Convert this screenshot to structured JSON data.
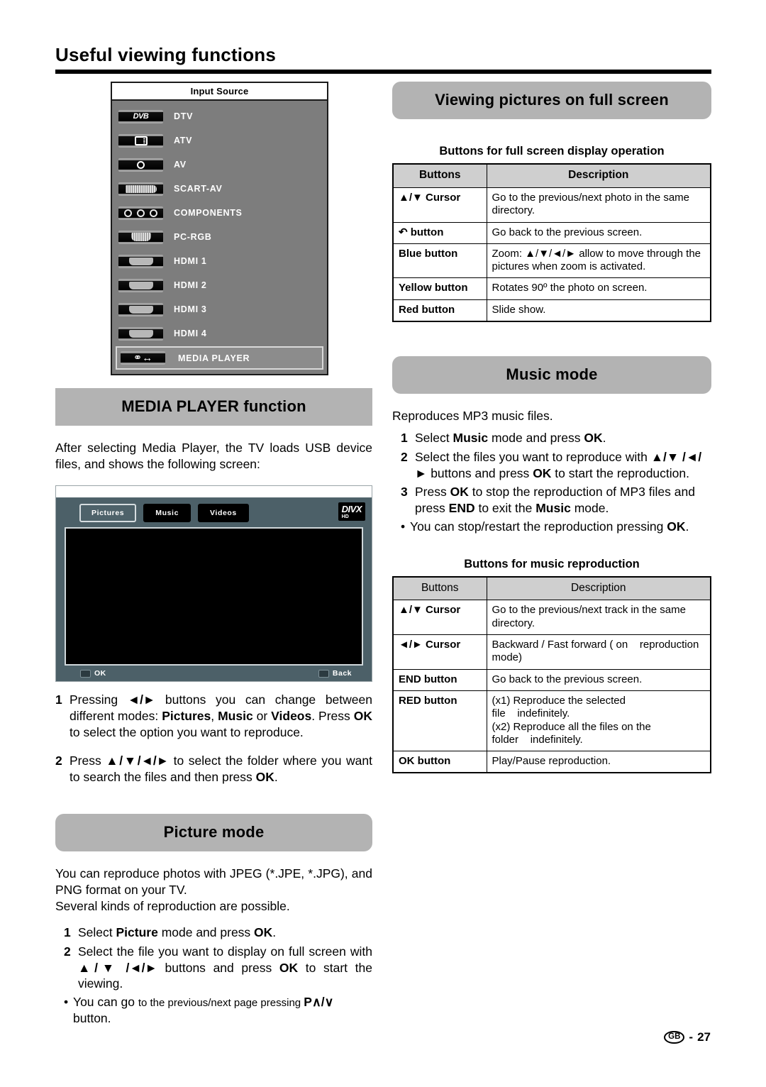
{
  "page": {
    "title": "Useful viewing functions",
    "footer_region": "GB",
    "footer_sep": "-",
    "footer_page": "27"
  },
  "input_source": {
    "panel_title": "Input Source",
    "items": [
      {
        "label": "DTV",
        "icon": "dvb-logo-icon",
        "selected": false
      },
      {
        "label": "ATV",
        "icon": "analog-tv-icon",
        "selected": false
      },
      {
        "label": "AV",
        "icon": "rca-composite-icon",
        "selected": false
      },
      {
        "label": "SCART-AV",
        "icon": "scart-connector-icon",
        "selected": false
      },
      {
        "label": "COMPONENTS",
        "icon": "component-jacks-icon",
        "selected": false
      },
      {
        "label": "PC-RGB",
        "icon": "vga-connector-icon",
        "selected": false
      },
      {
        "label": "HDMI 1",
        "icon": "hdmi-connector-icon",
        "selected": false
      },
      {
        "label": "HDMI 2",
        "icon": "hdmi-connector-icon",
        "selected": false
      },
      {
        "label": "HDMI 3",
        "icon": "hdmi-connector-icon",
        "selected": false
      },
      {
        "label": "HDMI 4",
        "icon": "hdmi-connector-icon",
        "selected": false
      },
      {
        "label": "MEDIA PLAYER",
        "icon": "usb-icon",
        "selected": true
      }
    ]
  },
  "media_player": {
    "banner": "MEDIA PLAYER function",
    "intro": "After selecting Media Player, the TV loads USB device files, and shows the following screen:",
    "screen": {
      "tabs": [
        {
          "label": "Pictures",
          "active": true
        },
        {
          "label": "Music",
          "active": false
        },
        {
          "label": "Videos",
          "active": false
        }
      ],
      "logo_top": "DIVX",
      "logo_bottom": "HD",
      "footer_ok": "OK",
      "footer_back": "Back"
    },
    "steps": [
      {
        "num": "1",
        "parts": [
          {
            "t": "Pressing ",
            "b": false
          },
          {
            "t": "◄/►",
            "b": true
          },
          {
            "t": " buttons you can change between different modes: ",
            "b": false
          },
          {
            "t": "Pictures",
            "b": true
          },
          {
            "t": ", ",
            "b": false
          },
          {
            "t": "Music",
            "b": true
          },
          {
            "t": " or ",
            "b": false
          },
          {
            "t": "Videos",
            "b": true
          },
          {
            "t": ". Press ",
            "b": false
          },
          {
            "t": "OK",
            "b": true
          },
          {
            "t": " to select the option you want to reproduce.",
            "b": false
          }
        ]
      },
      {
        "num": "2",
        "parts": [
          {
            "t": "Press ",
            "b": false
          },
          {
            "t": "▲/▼/◄/►",
            "b": true
          },
          {
            "t": " to select the folder where you want to search the files and then press ",
            "b": false
          },
          {
            "t": "OK",
            "b": true
          },
          {
            "t": ".",
            "b": false
          }
        ]
      }
    ]
  },
  "picture_mode": {
    "banner": "Picture mode",
    "intro_1": "You can reproduce photos with JPEG (*.JPE, *.JPG), and PNG format on your TV.",
    "intro_2": "Several kinds of reproduction are possible.",
    "steps": [
      {
        "num": "1",
        "parts": [
          {
            "t": "Select ",
            "b": false
          },
          {
            "t": "Picture",
            "b": true
          },
          {
            "t": " mode and press ",
            "b": false
          },
          {
            "t": "OK",
            "b": true
          },
          {
            "t": ".",
            "b": false
          }
        ]
      },
      {
        "num": "2",
        "parts": [
          {
            "t": "Select the file you want to display on full screen with ",
            "b": false
          },
          {
            "t": "▲/▼ /◄/►",
            "b": true
          },
          {
            "t": " buttons and press ",
            "b": false
          },
          {
            "t": "OK",
            "b": true
          },
          {
            "t": " to start the viewing.",
            "b": false
          }
        ]
      }
    ],
    "bullet": {
      "mark": "•",
      "parts": [
        {
          "t": "You can go ",
          "b": false,
          "small": false
        },
        {
          "t": "to the previous/next page pressing ",
          "b": false,
          "small": true
        },
        {
          "t": "P∧/∨",
          "b": true,
          "small": false
        },
        {
          "t": " button.",
          "b": false,
          "small": false
        }
      ]
    }
  },
  "full_screen": {
    "banner": "Viewing pictures on full screen",
    "table_caption": "Buttons for full screen display operation",
    "headers": {
      "buttons": "Buttons",
      "description": "Description"
    },
    "rows": [
      {
        "key": "▲/▼ Cursor",
        "value": "Go to the previous/next photo in the same directory."
      },
      {
        "key": "↶ button",
        "value": "Go back to the previous screen."
      },
      {
        "key": "Blue button",
        "value": "Zoom: ▲/▼/◄/► allow to move through the pictures when zoom is activated."
      },
      {
        "key": "Yellow button",
        "value": "Rotates 90º the photo on screen."
      },
      {
        "key": "Red button",
        "value": "Slide show."
      }
    ]
  },
  "music_mode": {
    "banner": "Music mode",
    "intro": "Reproduces MP3 music files.",
    "steps": [
      {
        "num": "1",
        "parts": [
          {
            "t": "Select ",
            "b": false
          },
          {
            "t": "Music",
            "b": true
          },
          {
            "t": " mode and press ",
            "b": false
          },
          {
            "t": "OK",
            "b": true
          },
          {
            "t": ".",
            "b": false
          }
        ]
      },
      {
        "num": "2",
        "parts": [
          {
            "t": "Select the files you want to reproduce with ",
            "b": false
          },
          {
            "t": "▲/▼ /◄/►",
            "b": true
          },
          {
            "t": " buttons and press ",
            "b": false
          },
          {
            "t": "OK",
            "b": true
          },
          {
            "t": " to start the reproduction.",
            "b": false
          }
        ]
      },
      {
        "num": "3",
        "parts": [
          {
            "t": "Press ",
            "b": false
          },
          {
            "t": "OK",
            "b": true
          },
          {
            "t": " to stop the reproduction of MP3 files and press ",
            "b": false
          },
          {
            "t": "END",
            "b": true
          },
          {
            "t": " to exit the ",
            "b": false
          },
          {
            "t": "Music",
            "b": true
          },
          {
            "t": " mode.",
            "b": false
          }
        ]
      }
    ],
    "bullet": {
      "mark": "•",
      "parts": [
        {
          "t": "You can stop/restart the reproduction pressing ",
          "b": false
        },
        {
          "t": "OK",
          "b": true
        },
        {
          "t": ".",
          "b": false
        }
      ]
    },
    "table_caption": "Buttons for music reproduction",
    "headers": {
      "buttons": "Buttons",
      "description": "Description"
    },
    "rows": [
      {
        "key": "▲/▼ Cursor",
        "value": "Go to the previous/next track in the same directory."
      },
      {
        "key": "◄/► Cursor",
        "value": "Backward / Fast forward ( on    reproduction mode)"
      },
      {
        "key": "END button",
        "value": "Go back to the previous screen."
      },
      {
        "key": "RED button",
        "value": "(x1) Reproduce the selected file    indefinitely.\n(x2) Reproduce all the files on the folder    indefinitely."
      },
      {
        "key": "OK button",
        "value": "Play/Pause reproduction."
      }
    ]
  },
  "colors": {
    "banner_grey": "#b3b3b3",
    "osd_grey": "#7d7d7d",
    "table_header_grey": "#cfcfcf",
    "tv_chrome": "#4c6068"
  }
}
